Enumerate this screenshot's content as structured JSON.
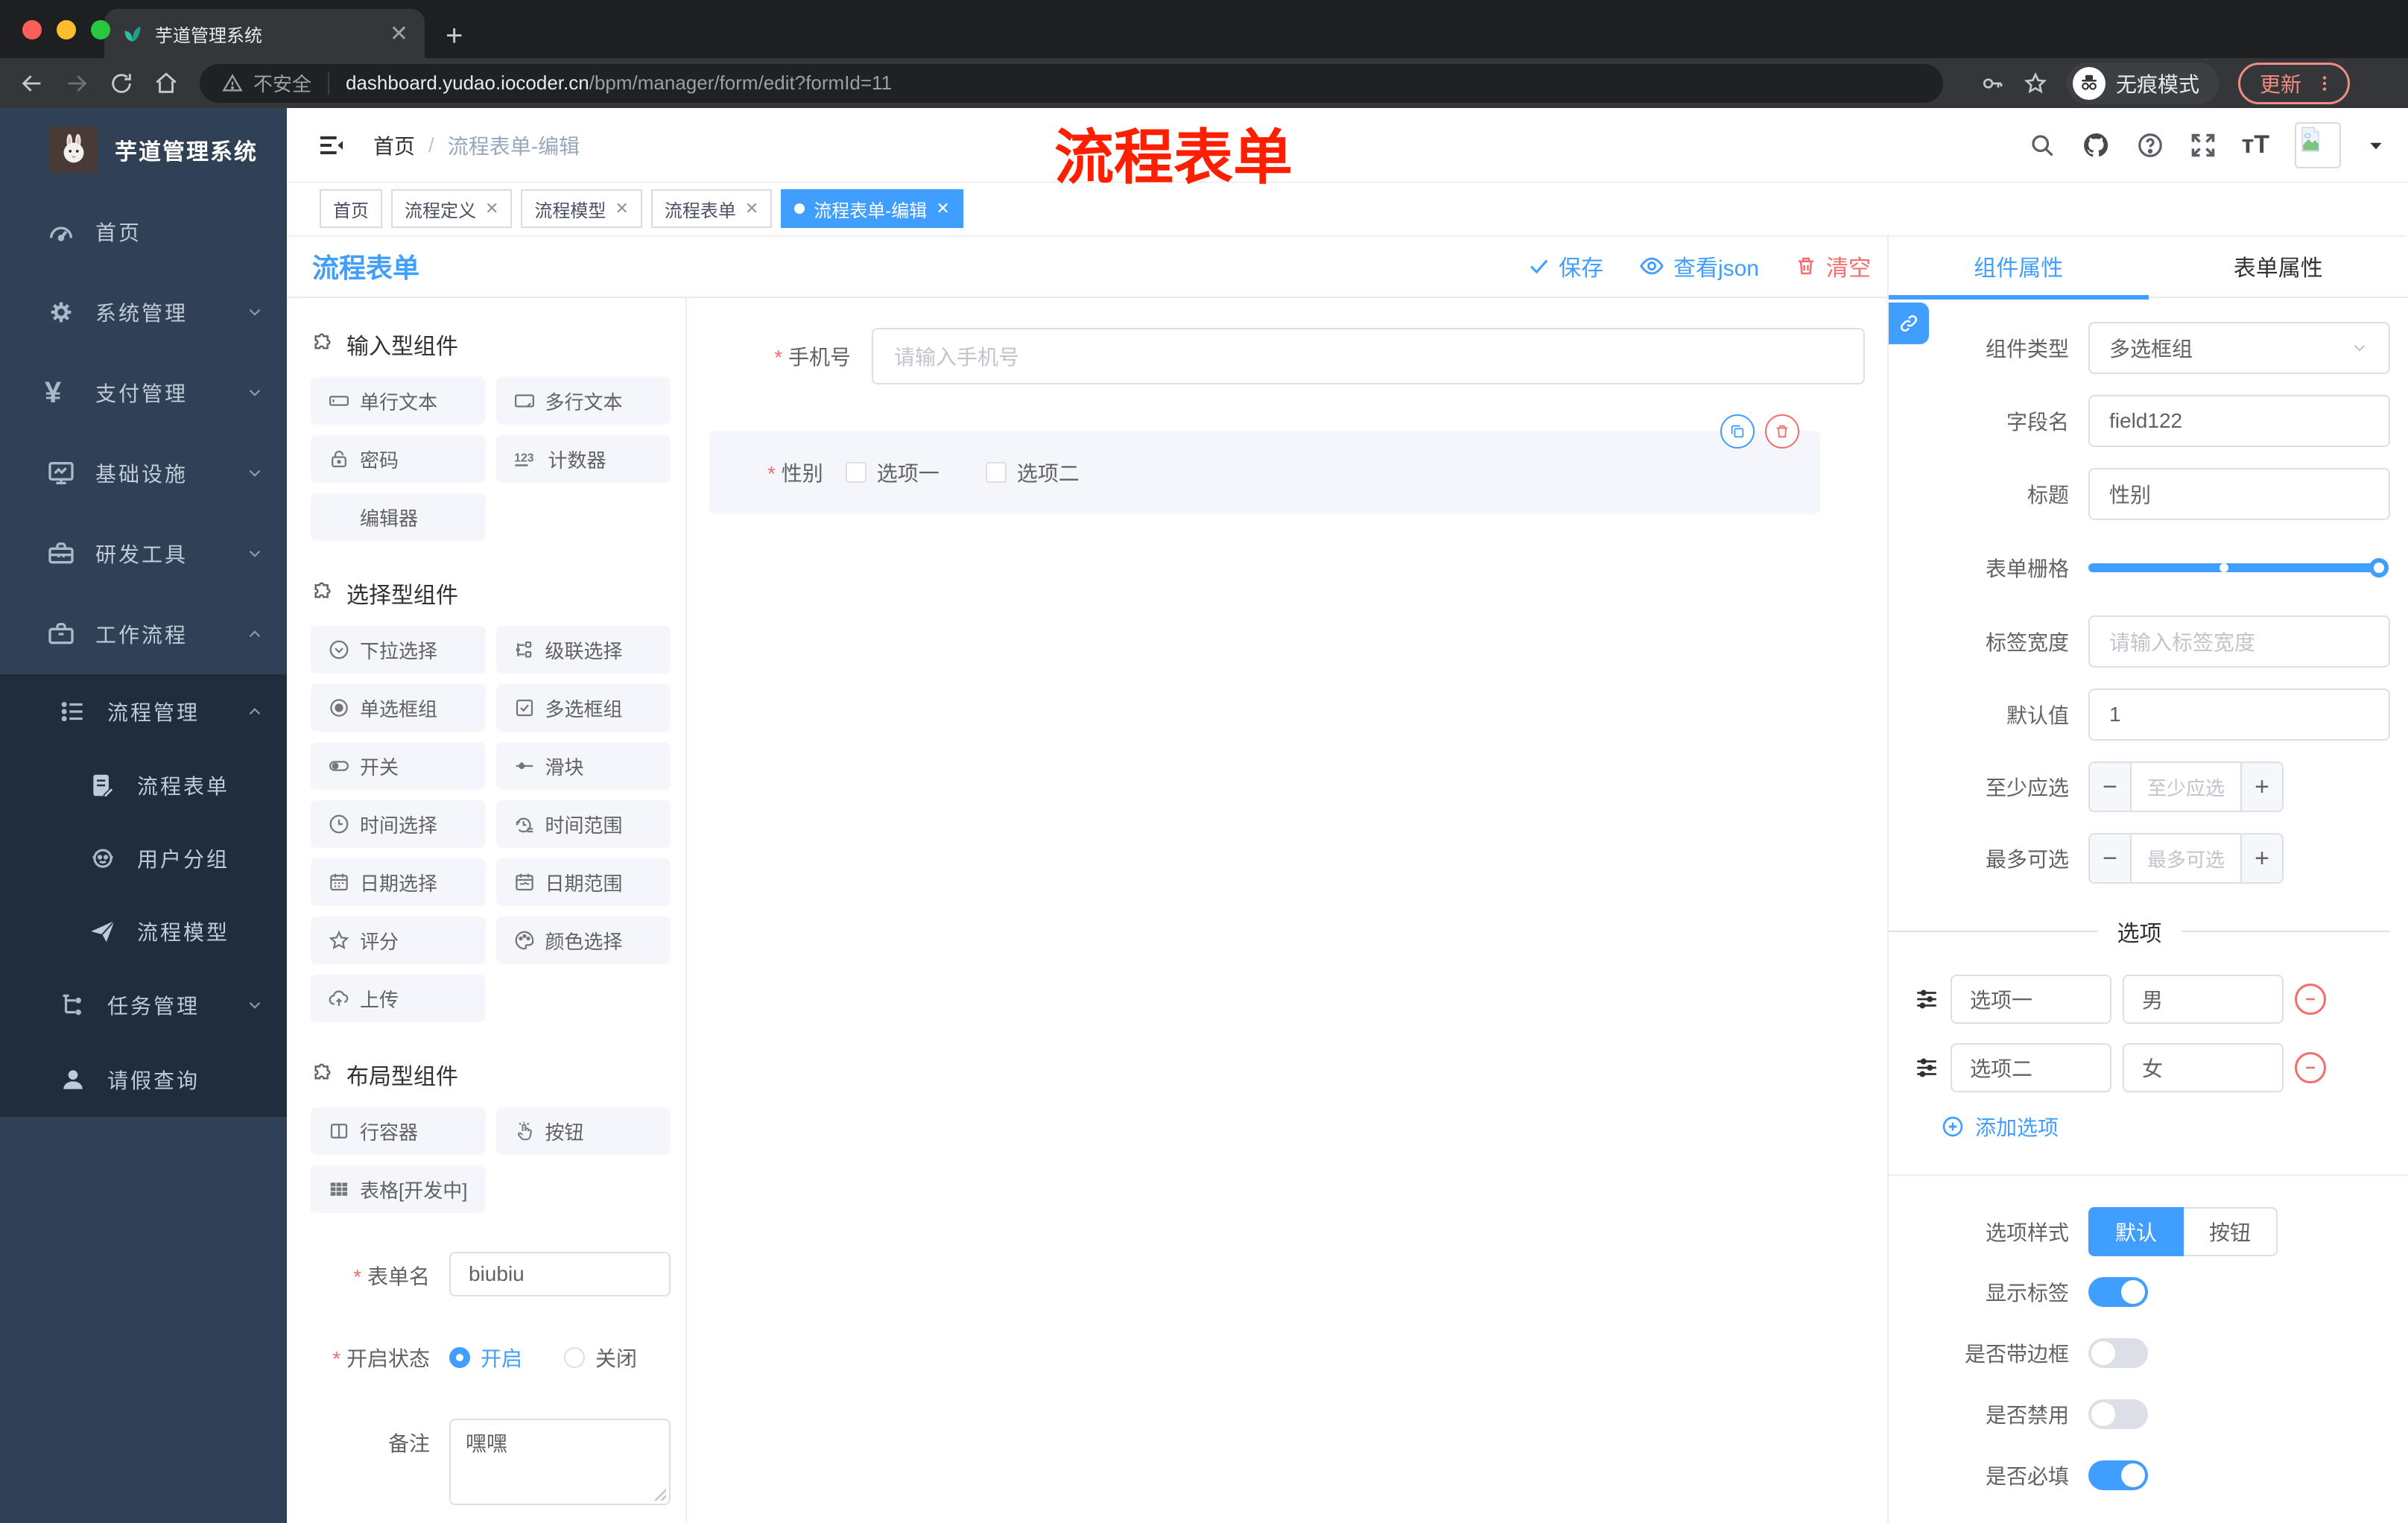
{
  "colors": {
    "accent": "#409eff",
    "danger": "#f56c6c",
    "warning_red_title": "#ff1f00",
    "sidebar_bg": "#304156",
    "sidebar_sub_bg": "#1f2d3d"
  },
  "browser": {
    "tab_title": "芋道管理系统",
    "security_label": "不安全",
    "url_host": "dashboard.yudao.iocoder.cn",
    "url_path": "/bpm/manager/form/edit?formId=11",
    "incognito_label": "无痕模式",
    "update_label": "更新"
  },
  "sidebar": {
    "app_title": "芋道管理系统",
    "items": [
      {
        "label": "首页",
        "icon": "dashboard-icon"
      },
      {
        "label": "系统管理",
        "icon": "gear-icon",
        "chevron": "down"
      },
      {
        "label": "支付管理",
        "icon": "yen-icon",
        "chevron": "down"
      },
      {
        "label": "基础设施",
        "icon": "monitor-icon",
        "chevron": "down"
      },
      {
        "label": "研发工具",
        "icon": "toolbox-icon",
        "chevron": "down"
      },
      {
        "label": "工作流程",
        "icon": "briefcase-icon",
        "chevron": "up"
      }
    ],
    "submenu": [
      {
        "label": "流程管理",
        "icon": "list-icon",
        "chevron": "up"
      },
      {
        "label": "流程表单",
        "icon": "form-doc-icon"
      },
      {
        "label": "用户分组",
        "icon": "user-group-icon"
      },
      {
        "label": "流程模型",
        "icon": "paper-plane-icon"
      },
      {
        "label": "任务管理",
        "icon": "tree-icon",
        "chevron": "down"
      },
      {
        "label": "请假查询",
        "icon": "person-icon"
      }
    ]
  },
  "navbar": {
    "breadcrumb": {
      "first": "首页",
      "separator": "/",
      "last": "流程表单-编辑"
    },
    "overlay_title": "流程表单"
  },
  "tags": [
    {
      "label": "首页"
    },
    {
      "label": "流程定义"
    },
    {
      "label": "流程模型"
    },
    {
      "label": "流程表单"
    },
    {
      "label": "流程表单-编辑"
    }
  ],
  "palette": {
    "title": "流程表单",
    "sections": [
      {
        "title": "输入型组件",
        "items": [
          {
            "label": "单行文本",
            "icon": "input-icon"
          },
          {
            "label": "多行文本",
            "icon": "textarea-icon"
          },
          {
            "label": "密码",
            "icon": "lock-icon"
          },
          {
            "label": "计数器",
            "icon": "counter-icon"
          },
          {
            "label": "编辑器",
            "icon": ""
          }
        ]
      },
      {
        "title": "选择型组件",
        "items": [
          {
            "label": "下拉选择",
            "icon": "select-icon"
          },
          {
            "label": "级联选择",
            "icon": "cascader-icon"
          },
          {
            "label": "单选框组",
            "icon": "radio-icon"
          },
          {
            "label": "多选框组",
            "icon": "checkbox-icon"
          },
          {
            "label": "开关",
            "icon": "switch-icon"
          },
          {
            "label": "滑块",
            "icon": "slider-icon"
          },
          {
            "label": "时间选择",
            "icon": "time-icon"
          },
          {
            "label": "时间范围",
            "icon": "time-range-icon"
          },
          {
            "label": "日期选择",
            "icon": "date-icon"
          },
          {
            "label": "日期范围",
            "icon": "date-range-icon"
          },
          {
            "label": "评分",
            "icon": "star-icon"
          },
          {
            "label": "颜色选择",
            "icon": "palette-icon"
          },
          {
            "label": "上传",
            "icon": "upload-icon"
          }
        ]
      },
      {
        "title": "布局型组件",
        "items": [
          {
            "label": "行容器",
            "icon": "columns-icon"
          },
          {
            "label": "按钮",
            "icon": "hand-click-icon"
          },
          {
            "label": "表格[开发中]",
            "icon": "table-icon"
          }
        ]
      }
    ]
  },
  "settings": {
    "form_name": {
      "label": "表单名",
      "value": "biubiu"
    },
    "status": {
      "label": "开启状态",
      "on_label": "开启",
      "off_label": "关闭",
      "selected": "开启"
    },
    "remark": {
      "label": "备注",
      "value": "嘿嘿"
    }
  },
  "canvas": {
    "toolbar": {
      "save": "保存",
      "view_json": "查看json",
      "clear": "清空"
    },
    "phone_field": {
      "label": "手机号",
      "placeholder": "请输入手机号"
    },
    "gender_field": {
      "label": "性别",
      "option1": "选项一",
      "option2": "选项二"
    }
  },
  "inspector": {
    "tabs": {
      "component": "组件属性",
      "form": "表单属性",
      "active": "组件属性"
    },
    "component_type": {
      "label": "组件类型",
      "value": "多选框组"
    },
    "field_name": {
      "label": "字段名",
      "value": "field122"
    },
    "title": {
      "label": "标题",
      "value": "性别"
    },
    "form_grid": {
      "label": "表单栅格",
      "value_percent": 100,
      "mark_percent": 47
    },
    "label_width": {
      "label": "标签宽度",
      "placeholder": "请输入标签宽度"
    },
    "default_value": {
      "label": "默认值",
      "value": "1"
    },
    "min_select": {
      "label": "至少应选",
      "placeholder": "至少应选"
    },
    "max_select": {
      "label": "最多可选",
      "placeholder": "最多可选"
    },
    "options": {
      "divider": "选项",
      "rows": [
        {
          "text": "选项一",
          "value": "男"
        },
        {
          "text": "选项二",
          "value": "女"
        }
      ],
      "add_label": "添加选项"
    },
    "option_style": {
      "label": "选项样式",
      "default_label": "默认",
      "button_label": "按钮",
      "active": "默认"
    },
    "switches": [
      {
        "label": "显示标签",
        "on": true
      },
      {
        "label": "是否带边框",
        "on": false
      },
      {
        "label": "是否禁用",
        "on": false
      },
      {
        "label": "是否必填",
        "on": true
      }
    ]
  }
}
